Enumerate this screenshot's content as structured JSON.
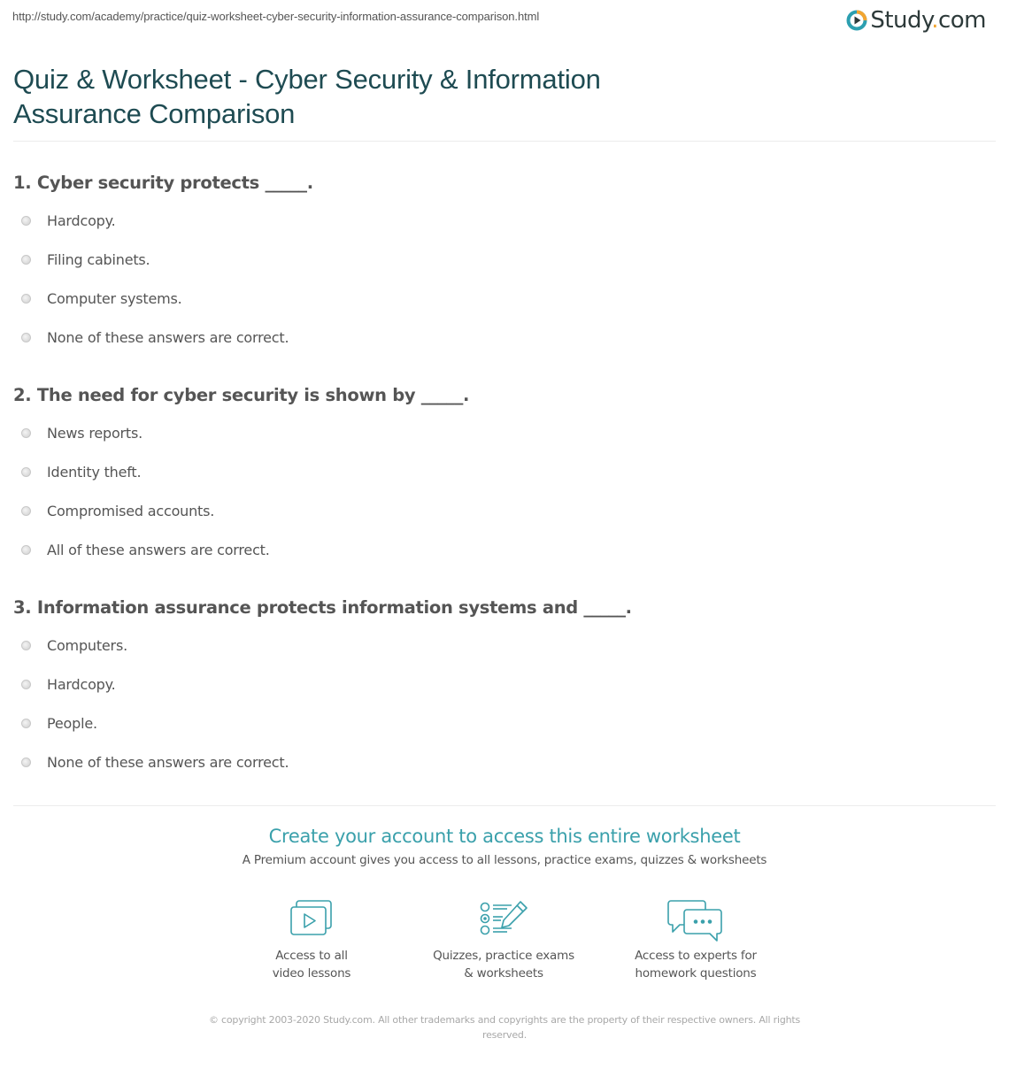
{
  "header": {
    "url": "http://study.com/academy/practice/quiz-worksheet-cyber-security-information-assurance-comparison.html",
    "logo": {
      "name": "Study",
      "dot": ".",
      "tld": "com",
      "icon": "play-circle-icon"
    }
  },
  "page_title": "Quiz & Worksheet - Cyber Security & Information Assurance Comparison",
  "questions": [
    {
      "text": "1. Cyber security protects _____.",
      "options": [
        "Hardcopy.",
        "Filing cabinets.",
        "Computer systems.",
        "None of these answers are correct."
      ]
    },
    {
      "text": "2. The need for cyber security is shown by _____.",
      "options": [
        "News reports.",
        "Identity theft.",
        "Compromised accounts.",
        "All of these answers are correct."
      ]
    },
    {
      "text": "3. Information assurance protects information systems and _____.",
      "options": [
        "Computers.",
        "Hardcopy.",
        "People.",
        "None of these answers are correct."
      ]
    }
  ],
  "cta": {
    "title": "Create your account to access this entire worksheet",
    "subtitle": "A Premium account gives you access to all lessons, practice exams, quizzes & worksheets",
    "features": [
      {
        "icon": "video-lessons-icon",
        "line1": "Access to all",
        "line2": "video lessons"
      },
      {
        "icon": "quiz-checklist-icon",
        "line1": "Quizzes, practice exams",
        "line2": "& worksheets"
      },
      {
        "icon": "chat-bubbles-icon",
        "line1": "Access to experts for",
        "line2": "homework questions"
      }
    ]
  },
  "footer": {
    "copyright_line1": "© copyright 2003-2020 Study.com. All other trademarks and copyrights are the property of their respective owners. All rights",
    "copyright_line2": "reserved."
  },
  "colors": {
    "title": "#1e4b52",
    "accent": "#3aa0ab",
    "logo_dot": "#f3a530"
  }
}
